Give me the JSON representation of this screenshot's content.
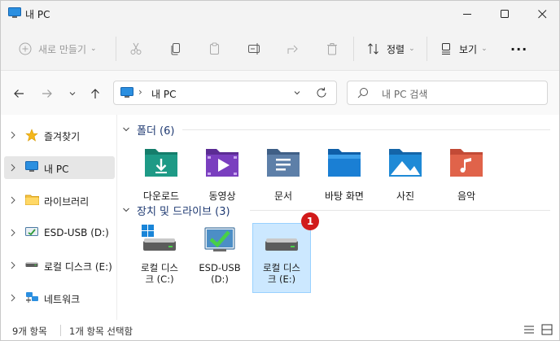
{
  "window": {
    "title": "내 PC"
  },
  "toolbar": {
    "new_label": "새로 만들기",
    "sort_label": "정렬",
    "view_label": "보기",
    "more_label": "···"
  },
  "address": {
    "path": "내 PC",
    "separator": "›"
  },
  "search": {
    "placeholder": "내 PC 검색"
  },
  "sidebar": {
    "items": [
      {
        "label": "즐겨찾기",
        "icon": "star-icon"
      },
      {
        "label": "내 PC",
        "icon": "pc-icon",
        "selected": true
      },
      {
        "label": "라이브러리",
        "icon": "library-folder-icon"
      },
      {
        "label": "ESD-USB (D:)",
        "icon": "usb-drive-icon"
      },
      {
        "label": "로컬 디스크 (E:)",
        "icon": "drive-icon"
      },
      {
        "label": "네트워크",
        "icon": "network-icon"
      }
    ]
  },
  "groups": {
    "folders": {
      "title": "폴더 (6)"
    },
    "drives": {
      "title": "장치 및 드라이브 (3)"
    }
  },
  "folders": [
    {
      "label": "다운로드",
      "icon": "downloads-folder-icon",
      "color": "#1e9a86"
    },
    {
      "label": "동영상",
      "icon": "videos-folder-icon",
      "color": "#7a3fbf"
    },
    {
      "label": "문서",
      "icon": "documents-folder-icon",
      "color": "#5d7fa8"
    },
    {
      "label": "바탕 화면",
      "icon": "desktop-folder-icon",
      "color": "#1a7fd4"
    },
    {
      "label": "사진",
      "icon": "pictures-folder-icon",
      "color": "#1f8ad6"
    },
    {
      "label": "음악",
      "icon": "music-folder-icon",
      "color": "#e0634a"
    }
  ],
  "drives": [
    {
      "line1": "로컬 디스",
      "line2": "크 (C:)",
      "icon": "windows-drive-icon"
    },
    {
      "line1": "ESD-USB",
      "line2": "(D:)",
      "icon": "usb-setup-drive-icon"
    },
    {
      "line1": "로컬 디스",
      "line2": "크 (E:)",
      "icon": "drive-icon",
      "selected": true
    }
  ],
  "badge": {
    "number": "1",
    "color": "#d11a1a"
  },
  "status": {
    "count": "9개 항목",
    "selection": "1개 항목 선택함"
  },
  "colors": {
    "accent": "#0067c0",
    "selected_bg": "#cce8ff"
  }
}
